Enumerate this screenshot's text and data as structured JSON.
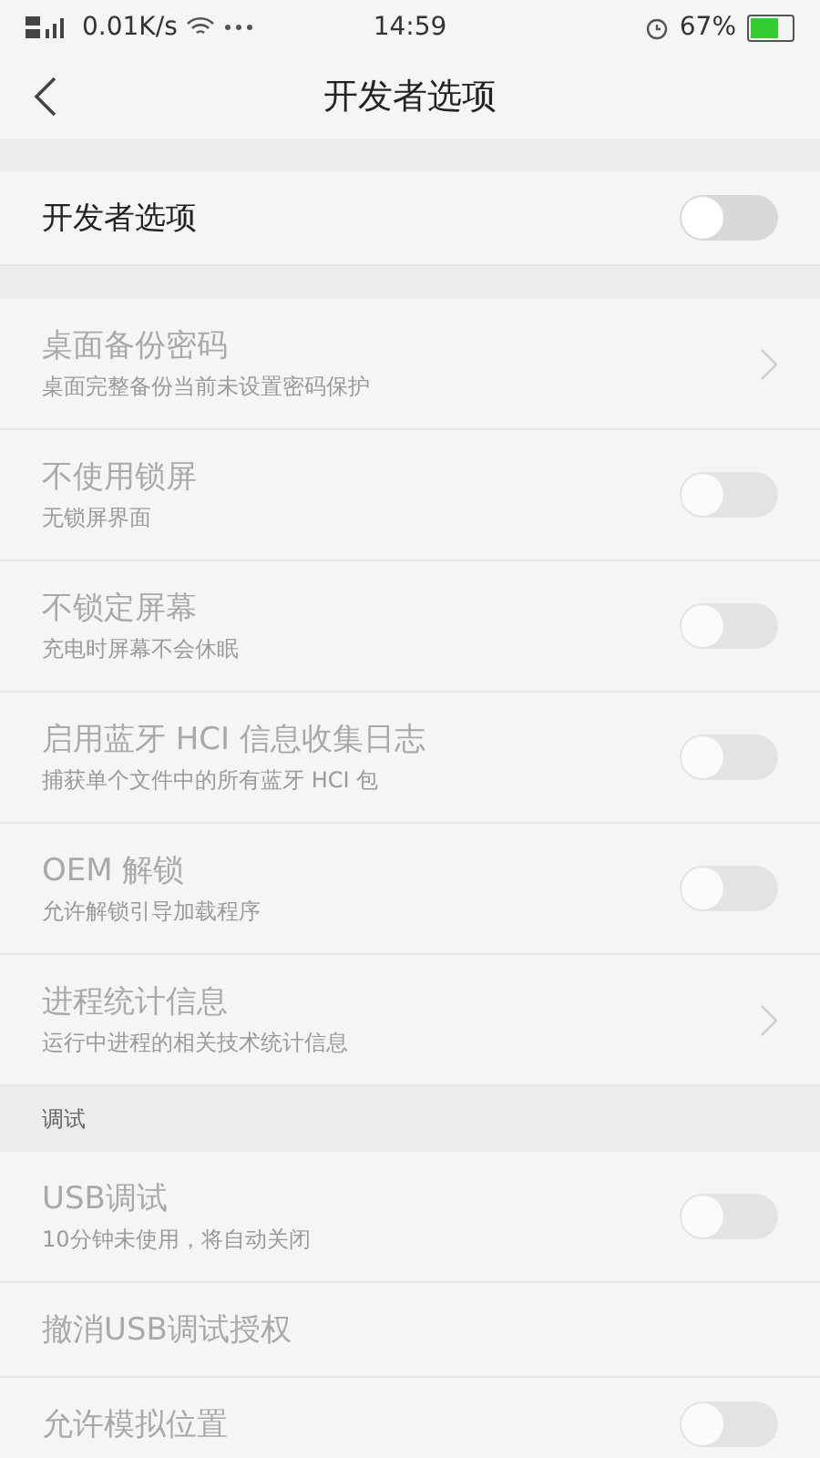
{
  "status_bar": {
    "network": "0.01K/s",
    "time": "14:59",
    "battery": "67%"
  },
  "header": {
    "title": "开发者选项"
  },
  "sections": [
    {
      "items": [
        {
          "kind": "toggle",
          "title": "开发者选项",
          "disabled": false,
          "on": false
        }
      ]
    },
    {
      "items": [
        {
          "kind": "chevron",
          "title": "桌面备份密码",
          "subtitle": "桌面完整备份当前未设置密码保护",
          "disabled": true
        },
        {
          "kind": "toggle",
          "title": "不使用锁屏",
          "subtitle": "无锁屏界面",
          "disabled": true,
          "on": false
        },
        {
          "kind": "toggle",
          "title": "不锁定屏幕",
          "subtitle": "充电时屏幕不会休眠",
          "disabled": true,
          "on": false
        },
        {
          "kind": "toggle",
          "title": "启用蓝牙 HCI 信息收集日志",
          "subtitle": "捕获单个文件中的所有蓝牙 HCI 包",
          "disabled": true,
          "on": false
        },
        {
          "kind": "toggle",
          "title": "OEM 解锁",
          "subtitle": "允许解锁引导加载程序",
          "disabled": true,
          "on": false
        },
        {
          "kind": "chevron",
          "title": "进程统计信息",
          "subtitle": "运行中进程的相关技术统计信息",
          "disabled": true
        }
      ]
    },
    {
      "header": "调试",
      "items": [
        {
          "kind": "toggle",
          "title": "USB调试",
          "subtitle": "10分钟未使用，将自动关闭",
          "disabled": true,
          "on": false
        },
        {
          "kind": "plain",
          "title": "撤消USB调试授权",
          "disabled": true
        },
        {
          "kind": "toggle",
          "title": "允许模拟位置",
          "disabled": true,
          "on": false
        }
      ]
    }
  ]
}
